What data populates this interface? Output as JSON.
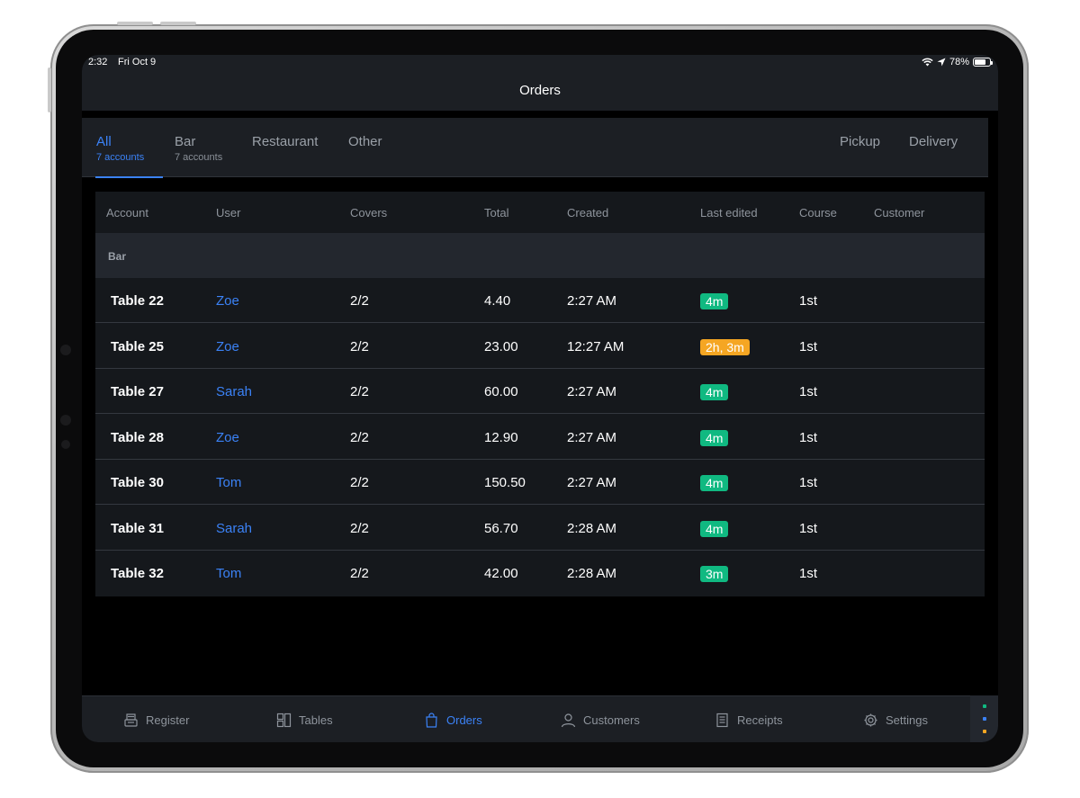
{
  "status_bar": {
    "time": "2:32",
    "date": "Fri Oct 9",
    "battery": "78%",
    "battery_level": 0.78
  },
  "nav": {
    "title": "Orders"
  },
  "filter_tabs": [
    {
      "label": "All",
      "sub": "7 accounts",
      "active": true
    },
    {
      "label": "Bar",
      "sub": "7 accounts",
      "active": false
    },
    {
      "label": "Restaurant",
      "sub": "",
      "active": false
    },
    {
      "label": "Other",
      "sub": "",
      "active": false
    }
  ],
  "right_tabs": [
    {
      "label": "Pickup"
    },
    {
      "label": "Delivery"
    }
  ],
  "table": {
    "columns": [
      "Account",
      "User",
      "Covers",
      "Total",
      "Created",
      "Last edited",
      "Course",
      "Customer"
    ],
    "group_label": "Bar",
    "rows": [
      {
        "account": "Table 22",
        "user": "Zoe",
        "covers": "2/2",
        "total": "4.40",
        "created": "2:27 AM",
        "last_edited": "4m",
        "status": "green",
        "course": "1st",
        "customer": ""
      },
      {
        "account": "Table 25",
        "user": "Zoe",
        "covers": "2/2",
        "total": "23.00",
        "created": "12:27 AM",
        "last_edited": "2h, 3m",
        "status": "orange",
        "course": "1st",
        "customer": ""
      },
      {
        "account": "Table 27",
        "user": "Sarah",
        "covers": "2/2",
        "total": "60.00",
        "created": "2:27 AM",
        "last_edited": "4m",
        "status": "green",
        "course": "1st",
        "customer": ""
      },
      {
        "account": "Table 28",
        "user": "Zoe",
        "covers": "2/2",
        "total": "12.90",
        "created": "2:27 AM",
        "last_edited": "4m",
        "status": "green",
        "course": "1st",
        "customer": ""
      },
      {
        "account": "Table 30",
        "user": "Tom",
        "covers": "2/2",
        "total": "150.50",
        "created": "2:27 AM",
        "last_edited": "4m",
        "status": "green",
        "course": "1st",
        "customer": ""
      },
      {
        "account": "Table 31",
        "user": "Sarah",
        "covers": "2/2",
        "total": "56.70",
        "created": "2:28 AM",
        "last_edited": "4m",
        "status": "green",
        "course": "1st",
        "customer": ""
      },
      {
        "account": "Table 32",
        "user": "Tom",
        "covers": "2/2",
        "total": "42.00",
        "created": "2:28 AM",
        "last_edited": "3m",
        "status": "green",
        "course": "1st",
        "customer": ""
      }
    ]
  },
  "tab_bar": [
    {
      "label": "Register",
      "icon": "register-icon",
      "active": false
    },
    {
      "label": "Tables",
      "icon": "tables-icon",
      "active": false
    },
    {
      "label": "Orders",
      "icon": "shopping-bag-icon",
      "active": true
    },
    {
      "label": "Customers",
      "icon": "customers-icon",
      "active": false
    },
    {
      "label": "Receipts",
      "icon": "receipt-icon",
      "active": false
    },
    {
      "label": "Settings",
      "icon": "gear-icon",
      "active": false
    }
  ],
  "colors": {
    "accent": "#3b82f6",
    "badge_green": "#10b981",
    "badge_orange": "#f5a623",
    "panel": "#1c1f24",
    "background": "#000000"
  }
}
